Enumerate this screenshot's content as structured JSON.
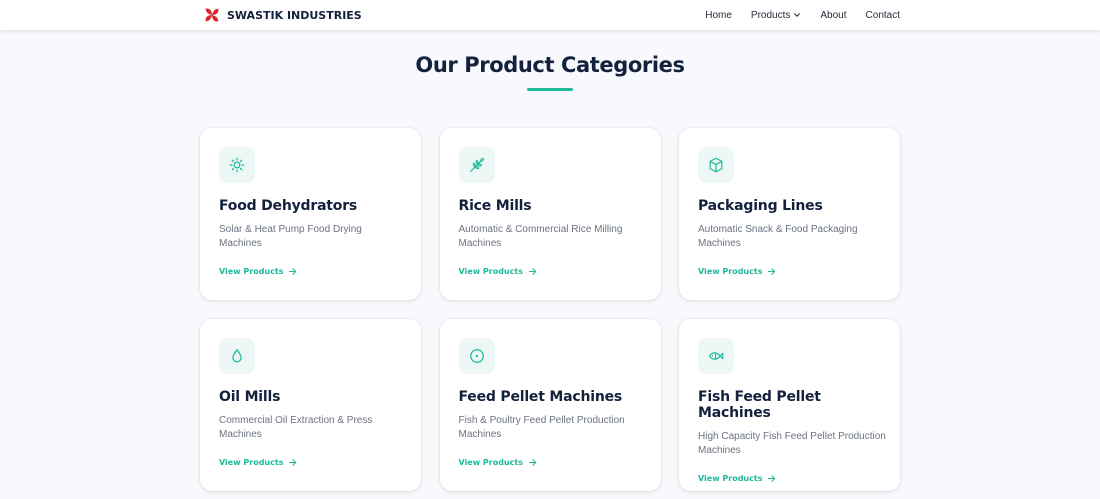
{
  "brand": {
    "name": "SWASTIK INDUSTRIES",
    "logo_icon": "red-pinwheel-icon"
  },
  "nav": {
    "home": "Home",
    "products": "Products",
    "about": "About",
    "contact": "Contact"
  },
  "section": {
    "title": "Our Product Categories"
  },
  "colors": {
    "accent": "#1eb89b",
    "heading": "#14213d",
    "logo": "#d7262e",
    "icon_bg": "#edf7f5",
    "page_bg": "#f8f9fc"
  },
  "link_label": "View Products",
  "categories": [
    {
      "icon": "sun-icon",
      "title": "Food Dehydrators",
      "description": "Solar & Heat Pump Food Drying Machines",
      "link": "View Products"
    },
    {
      "icon": "wheat-icon",
      "title": "Rice Mills",
      "description": "Automatic & Commercial Rice Milling Machines",
      "link": "View Products"
    },
    {
      "icon": "package-icon",
      "title": "Packaging Lines",
      "description": "Automatic Snack & Food Packaging Machines",
      "link": "View Products"
    },
    {
      "icon": "droplet-icon",
      "title": "Oil Mills",
      "description": "Commercial Oil Extraction & Press Machines",
      "link": "View Products"
    },
    {
      "icon": "target-icon",
      "title": "Feed Pellet Machines",
      "description": "Fish & Poultry Feed Pellet Production Machines",
      "link": "View Products"
    },
    {
      "icon": "fish-icon",
      "title": "Fish Feed Pellet Machines",
      "description": "High Capacity Fish Feed Pellet Production Machines",
      "link": "View Products"
    }
  ]
}
